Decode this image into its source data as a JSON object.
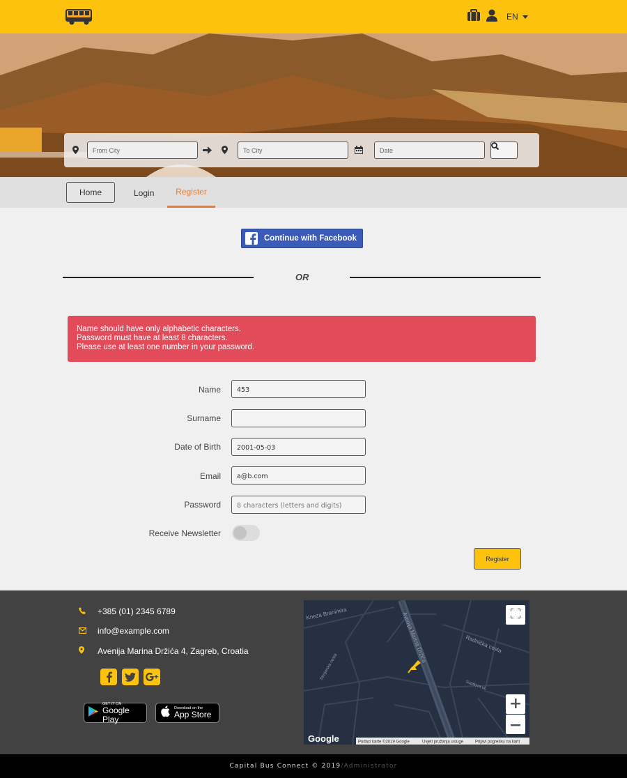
{
  "header": {
    "language": "EN"
  },
  "search": {
    "from_placeholder": "From City",
    "to_placeholder": "To City",
    "date_placeholder": "Date"
  },
  "nav": {
    "home": "Home",
    "login": "Login",
    "register": "Register"
  },
  "social_login": {
    "facebook_label": "Continue with Facebook",
    "separator": "OR"
  },
  "alert": {
    "messages": [
      "Name should have only alphabetic characters.",
      "Password must have at least 8 characters.",
      "Please use at least one number in your password."
    ]
  },
  "form": {
    "name_label": "Name",
    "name_value": "453",
    "surname_label": "Surname",
    "surname_value": "",
    "dob_label": "Date of Birth",
    "dob_value": "2001-05-03",
    "email_label": "Email",
    "email_value": "a@b.com",
    "password_label": "Password",
    "password_placeholder": "8 characters (letters and digits)",
    "newsletter_label": "Receive Newsletter",
    "newsletter_on": false,
    "submit_label": "Register"
  },
  "footer": {
    "phone": "+385 (01) 2345 6789",
    "email": "info@example.com",
    "address": "Avenija Marina Držića 4, Zagreb, Croatia",
    "google_play_small": "GET IT ON",
    "google_play_big": "Google Play",
    "app_store_small": "Download on the",
    "app_store_big": "App Store",
    "accent_color": "#fdc20e"
  },
  "map": {
    "streets": [
      "Kneza Branimira",
      "Avenija Marina Držića",
      "Radnička cesta",
      "Supilova ul.",
      "Strojarska cesta"
    ],
    "google_label": "Google",
    "attribution": [
      "Podaci karte ©2019 Google",
      "Uvjeti pružanja usluge",
      "Prijavi pogrešku na karti"
    ]
  },
  "copyright": {
    "text": "Capital Bus Connect © 2019",
    "admin_link": "/Administrator"
  },
  "colors": {
    "brand_yellow": "#fdc20e",
    "active_tab": "#f07a2d",
    "alert_red": "#e14b5a",
    "facebook_blue": "#3b5bb8"
  }
}
